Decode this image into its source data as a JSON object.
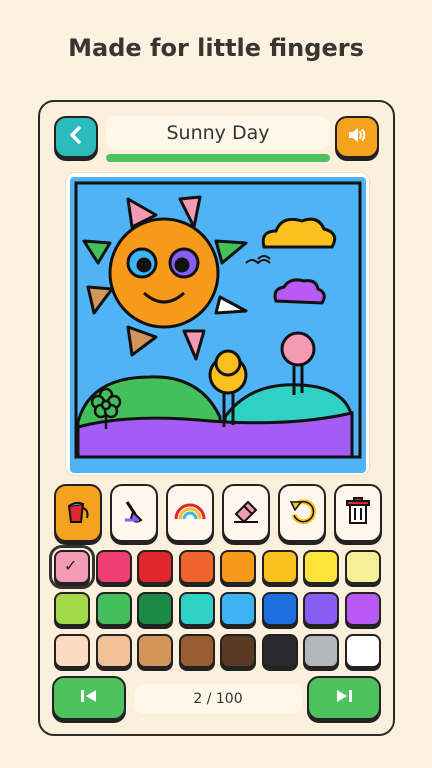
{
  "headline": "Made for little fingers",
  "header": {
    "title": "Sunny Day",
    "progress": 1.0,
    "back_icon": "chevron-left-icon",
    "sound_icon": "speaker-icon"
  },
  "tools": [
    {
      "name": "paint-bucket",
      "icon": "paint-bucket-icon",
      "active": true
    },
    {
      "name": "brush",
      "icon": "brush-icon",
      "active": false
    },
    {
      "name": "rainbow",
      "icon": "rainbow-icon",
      "active": false
    },
    {
      "name": "eraser",
      "icon": "eraser-icon",
      "active": false
    },
    {
      "name": "undo",
      "icon": "undo-icon",
      "active": false
    },
    {
      "name": "trash",
      "icon": "trash-icon",
      "active": false
    }
  ],
  "palette": [
    [
      "#f39ab4",
      "#ef3f72",
      "#e1262d",
      "#f0642d",
      "#f79a1c",
      "#fbbf1e",
      "#fde33a",
      "#f7ee9a"
    ],
    [
      "#a3d94a",
      "#43c05b",
      "#1d8a45",
      "#2ed1c4",
      "#3fb4f4",
      "#1d6fe0",
      "#8a5cf6",
      "#b95af5"
    ],
    [
      "#fcdcbf",
      "#f3c196",
      "#d4955a",
      "#9a5d32",
      "#5a3a22",
      "#2a2a2e",
      "#b4b6bb",
      "#ffffff"
    ]
  ],
  "selected_color": "#f39ab4",
  "pager": {
    "text": "2 / 100",
    "prev_icon": "skip-back-icon",
    "next_icon": "skip-forward-icon"
  }
}
